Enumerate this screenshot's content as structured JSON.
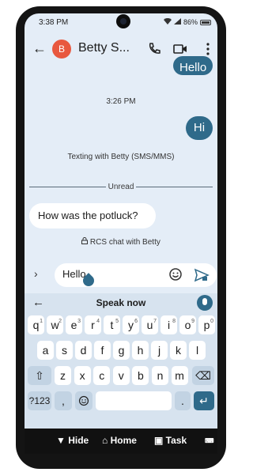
{
  "status": {
    "time": "3:38 PM",
    "battery": "86%"
  },
  "header": {
    "avatar_letter": "B",
    "contact_name": "Betty S..."
  },
  "messages": {
    "top_out": "Hello",
    "timestamp": "3:26 PM",
    "hi": "Hi",
    "texting_note": "Texting with Betty (SMS/MMS)",
    "unread_label": "Unread",
    "incoming": "How was the potluck?",
    "rcs_note": "RCS chat with Betty"
  },
  "compose": {
    "value": "Hello"
  },
  "keyboard": {
    "speak_label": "Speak now",
    "row1": [
      {
        "k": "q",
        "n": "1"
      },
      {
        "k": "w",
        "n": "2"
      },
      {
        "k": "e",
        "n": "3"
      },
      {
        "k": "r",
        "n": "4"
      },
      {
        "k": "t",
        "n": "5"
      },
      {
        "k": "y",
        "n": "6"
      },
      {
        "k": "u",
        "n": "7"
      },
      {
        "k": "i",
        "n": "8"
      },
      {
        "k": "o",
        "n": "9"
      },
      {
        "k": "p",
        "n": "0"
      }
    ],
    "row2": [
      "a",
      "s",
      "d",
      "f",
      "g",
      "h",
      "j",
      "k",
      "l"
    ],
    "row3": [
      "z",
      "x",
      "c",
      "v",
      "b",
      "n",
      "m"
    ],
    "sym_label": "?123",
    "comma": ",",
    "period": "."
  },
  "nav": {
    "hide": "Hide",
    "home": "Home",
    "task": "Task"
  }
}
